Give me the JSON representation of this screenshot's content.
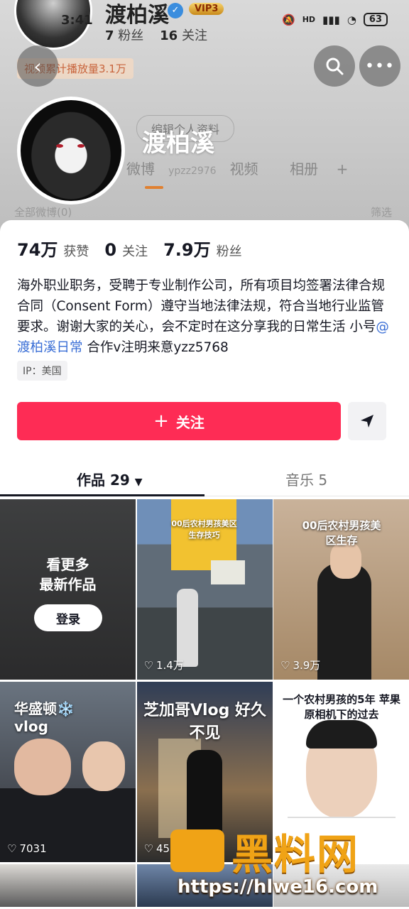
{
  "status_bar": {
    "time": "3:41",
    "signal": "HD",
    "battery": "63"
  },
  "background_header": {
    "name": "渡柏溪",
    "vip": "VIP3",
    "stats_followers": "7",
    "stats_followers_label": "粉丝",
    "stats_following": "16",
    "stats_following_label": "关注",
    "plays": "视频累计播放量3.1万",
    "edit_profile": "编辑个人资料",
    "tab_weibo": "微博",
    "tab_video": "视频",
    "tab_album": "相册",
    "douyin_id": "ypzz2976",
    "filter_left": "全部微博(0)",
    "filter_right": "筛选"
  },
  "profile": {
    "name": "渡柏溪"
  },
  "stats": {
    "likes_num": "74万",
    "likes_label": "获赞",
    "following_num": "0",
    "following_label": "关注",
    "followers_num": "7.9万",
    "followers_label": "粉丝"
  },
  "bio": {
    "text": "海外职业职务，受聘于专业制作公司，所有项目均签署法律合规合同（Consent Form）遵守当地法律法规，符合当地行业监管要求。谢谢大家的关心，会不定时在这分享我的日常生活 小号",
    "mention": "@渡柏溪日常",
    "suffix": " 合作v注明来意yzz5768"
  },
  "ip_tag": "IP：美国",
  "actions": {
    "follow_label": "关注",
    "follow_icon": "plus-icon",
    "share_icon": "send-icon"
  },
  "tabs": {
    "works": "作品 29",
    "music": "音乐 5"
  },
  "grid": {
    "locked": {
      "line1": "看更多",
      "line2": "最新作品",
      "login": "登录"
    },
    "videos": [
      {
        "caption": "00后农村男孩美区生存技巧",
        "likes": "1.4万"
      },
      {
        "caption": "00后农村男孩美区生存",
        "likes": "3.9万"
      },
      {
        "caption": "华盛顿❄️ vlog",
        "likes": "7031"
      },
      {
        "caption": "芝加哥Vlog 好久不见",
        "likes": "45"
      },
      {
        "caption": "一个农村男孩的5年 苹果原相机下的过去",
        "likes": ""
      }
    ]
  },
  "watermark": {
    "text": "黑料网",
    "url": "https://hlwe16.com"
  }
}
